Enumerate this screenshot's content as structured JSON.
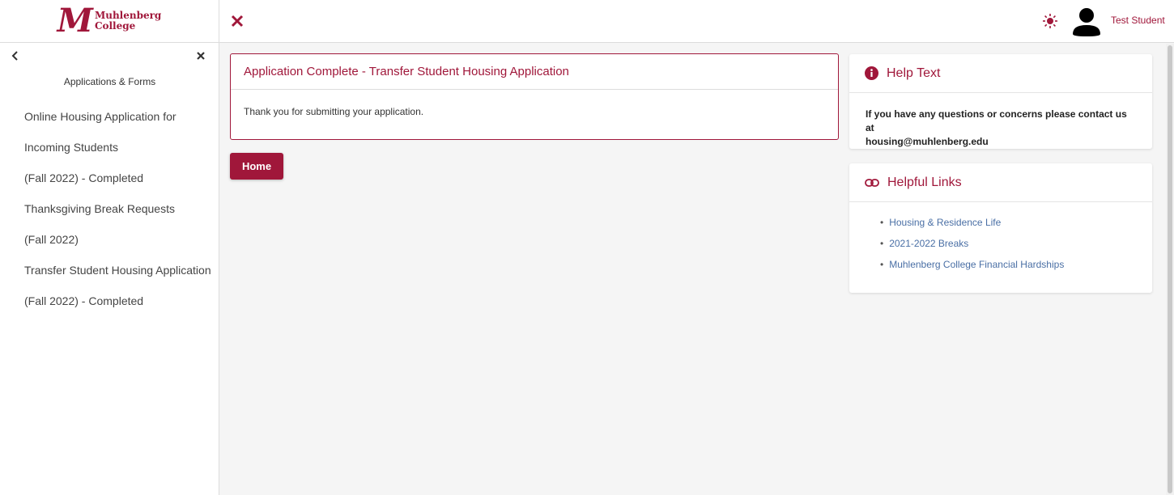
{
  "brand": {
    "name_line1": "Muhlenberg",
    "name_line2": "College",
    "accent": "#a0173a"
  },
  "sidebar": {
    "title": "Applications & Forms",
    "items": [
      "Online Housing Application for",
      "Incoming Students",
      "(Fall 2022) - Completed",
      "Thanksgiving Break Requests",
      "(Fall 2022)",
      "Transfer Student Housing Application",
      "(Fall 2022) - Completed"
    ]
  },
  "header": {
    "user_name": "Test Student"
  },
  "main": {
    "card_title": "Application Complete - Transfer Student Housing Application",
    "card_body": "Thank you for submitting your application.",
    "home_button": "Home"
  },
  "help": {
    "title": "Help Text",
    "body_line1": "If you have any questions or concerns please contact us at",
    "body_line2": "housing@muhlenberg.edu"
  },
  "links": {
    "title": "Helpful Links",
    "items": [
      "Housing & Residence Life",
      "2021-2022 Breaks",
      "Muhlenberg College Financial Hardships"
    ]
  }
}
